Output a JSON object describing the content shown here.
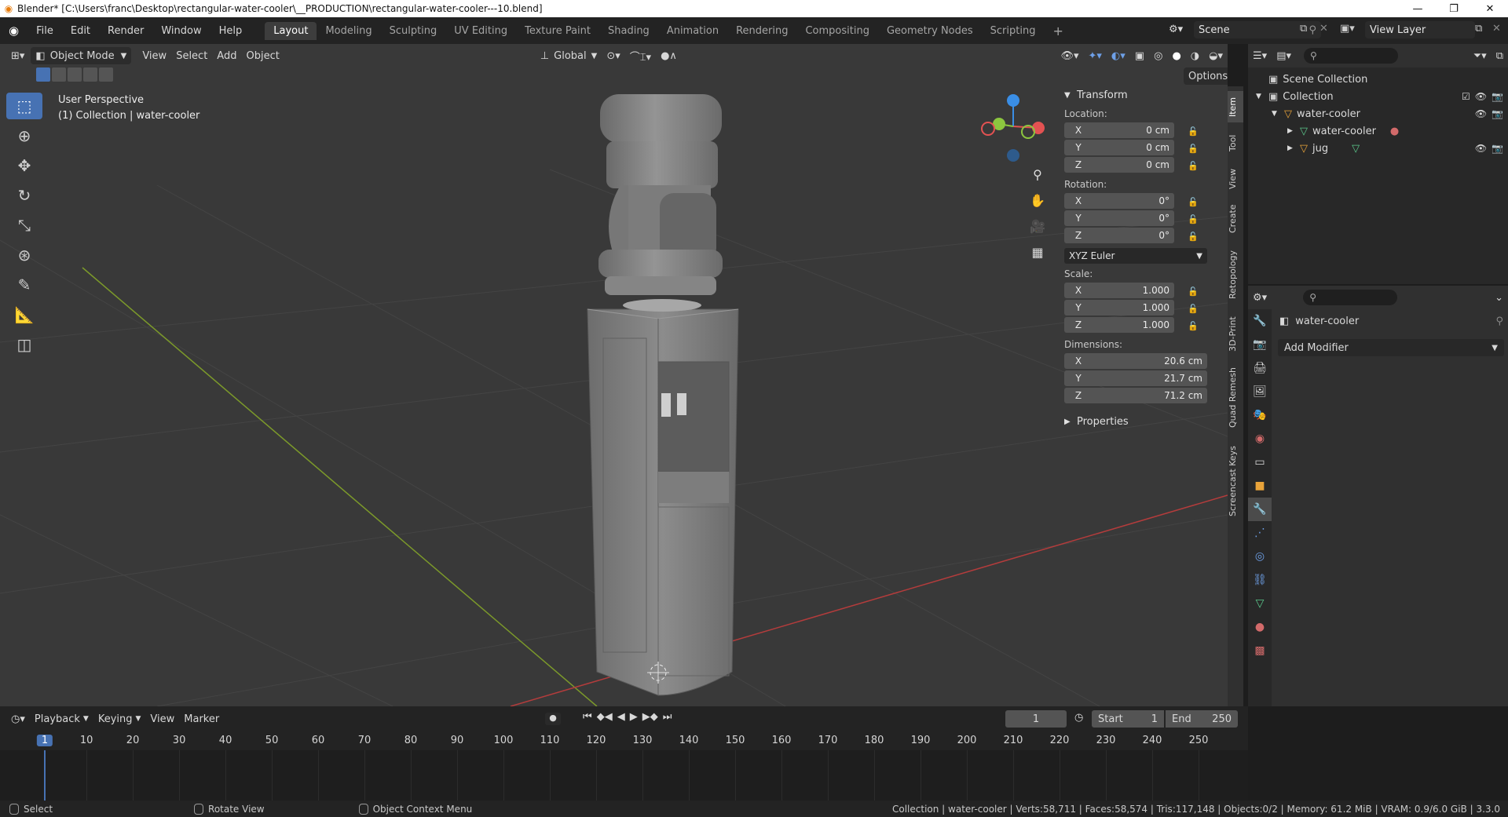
{
  "window": {
    "title": "Blender* [C:\\Users\\franc\\Desktop\\rectangular-water-cooler\\__PRODUCTION\\rectangular-water-cooler---10.blend]",
    "controls": [
      "—",
      "❐",
      "✕"
    ]
  },
  "topbar": {
    "menus": [
      "File",
      "Edit",
      "Render",
      "Window",
      "Help"
    ],
    "workspaces": [
      "Layout",
      "Modeling",
      "Sculpting",
      "UV Editing",
      "Texture Paint",
      "Shading",
      "Animation",
      "Rendering",
      "Compositing",
      "Geometry Nodes",
      "Scripting"
    ],
    "active_workspace": "Layout",
    "add_workspace": "+",
    "scene": "Scene",
    "view_layer": "View Layer"
  },
  "viewport": {
    "mode": "Object Mode",
    "menus": [
      "View",
      "Select",
      "Add",
      "Object"
    ],
    "orientation": "Global",
    "options_label": "Options",
    "info_line1": "User Perspective",
    "info_line2": "(1) Collection | water-cooler",
    "tools": [
      "select-box",
      "cursor",
      "move",
      "rotate",
      "scale",
      "transform",
      "annotate",
      "measure",
      "add-cube"
    ]
  },
  "npanel": {
    "section": "Transform",
    "location_label": "Location:",
    "location": {
      "x": "0 cm",
      "y": "0 cm",
      "z": "0 cm"
    },
    "rotation_label": "Rotation:",
    "rotation": {
      "x": "0°",
      "y": "0°",
      "z": "0°"
    },
    "rotation_mode": "XYZ Euler",
    "scale_label": "Scale:",
    "scale": {
      "x": "1.000",
      "y": "1.000",
      "z": "1.000"
    },
    "dimensions_label": "Dimensions:",
    "dimensions": {
      "x": "20.6 cm",
      "y": "21.7 cm",
      "z": "71.2 cm"
    },
    "properties_label": "Properties",
    "axis": {
      "x": "X",
      "y": "Y",
      "z": "Z"
    },
    "tabs": [
      "Item",
      "Tool",
      "View",
      "Create",
      "Retopology",
      "3D-Print",
      "Quad Remesh",
      "Screencast Keys"
    ]
  },
  "outliner": {
    "scene_collection": "Scene Collection",
    "collection": "Collection",
    "object": "water-cooler",
    "mesh": "water-cooler",
    "child": "jug"
  },
  "properties": {
    "object_name": "water-cooler",
    "add_modifier": "Add Modifier"
  },
  "timeline": {
    "menus": [
      "Playback",
      "Keying",
      "View",
      "Marker"
    ],
    "current_frame": "1",
    "start_label": "Start",
    "start": "1",
    "end_label": "End",
    "end": "250",
    "ruler": [
      "1",
      "10",
      "20",
      "30",
      "40",
      "50",
      "60",
      "70",
      "80",
      "90",
      "100",
      "110",
      "120",
      "130",
      "140",
      "150",
      "160",
      "170",
      "180",
      "190",
      "200",
      "210",
      "220",
      "230",
      "240",
      "250"
    ]
  },
  "statusbar": {
    "select": "Select",
    "rotate": "Rotate View",
    "context": "Object Context Menu",
    "stats": "Collection | water-cooler | Verts:58,711 | Faces:58,574 | Tris:117,148 | Objects:0/2 | Memory: 61.2 MiB | VRAM: 0.9/6.0 GiB | 3.3.0"
  },
  "colors": {
    "accent": "#4772b3",
    "x_axis": "#e35252",
    "y_axis": "#8cc63f",
    "z_axis": "#3a8ee6",
    "object_orange": "#e8a33a"
  }
}
